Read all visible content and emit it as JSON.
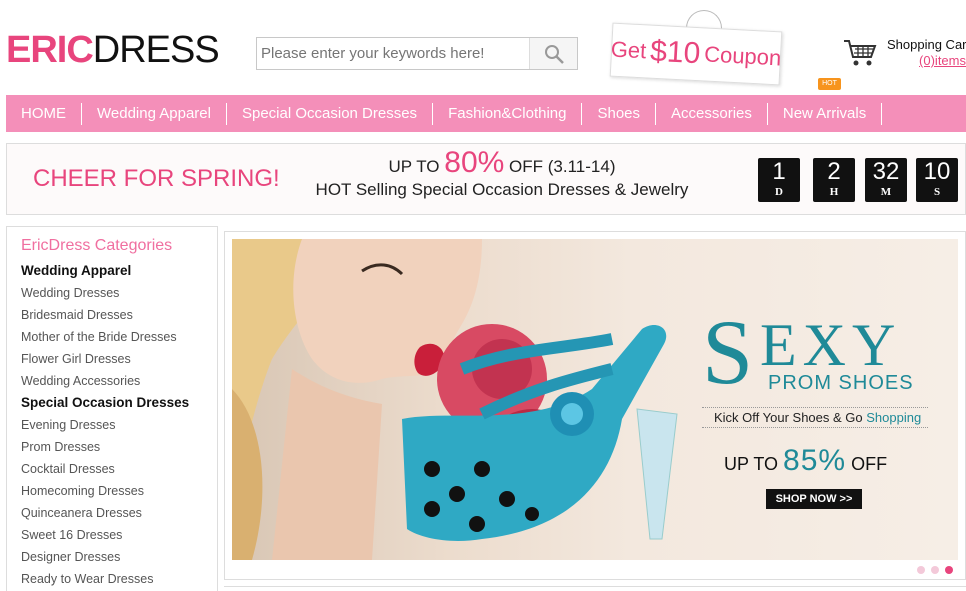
{
  "brand": {
    "logo_part1": "ERIC",
    "logo_part2": "DRESS"
  },
  "search": {
    "placeholder": "Please enter your keywords here!",
    "button_icon": "search-icon"
  },
  "coupon": {
    "text_before": "Get",
    "amount": "$10",
    "text_after": "Coupon"
  },
  "cart": {
    "label": "Shopping Cart",
    "items": "(0)items",
    "icon": "cart-icon"
  },
  "hot_badge": "HOT",
  "nav": {
    "items": [
      {
        "label": "HOME"
      },
      {
        "label": "Wedding Apparel"
      },
      {
        "label": "Special Occasion Dresses"
      },
      {
        "label": "Fashion&Clothing"
      },
      {
        "label": "Shoes"
      },
      {
        "label": "Accessories"
      },
      {
        "label": "New Arrivals"
      }
    ]
  },
  "promo": {
    "left": "CHEER FOR SPRING!",
    "up_to": "UP TO",
    "percent": "80%",
    "off_dates": "OFF (3.11-14)",
    "subline": "HOT Selling Special Occasion Dresses & Jewelry",
    "countdown": [
      {
        "value": "1",
        "unit": "D"
      },
      {
        "value": "2",
        "unit": "H"
      },
      {
        "value": "32",
        "unit": "M"
      },
      {
        "value": "10",
        "unit": "S"
      }
    ]
  },
  "sidebar": {
    "title": "EricDress Categories",
    "rows": [
      {
        "label": "Wedding Apparel",
        "group": true
      },
      {
        "label": "Wedding Dresses",
        "group": false
      },
      {
        "label": "Bridesmaid Dresses",
        "group": false
      },
      {
        "label": "Mother of the Bride Dresses",
        "group": false
      },
      {
        "label": "Flower Girl Dresses",
        "group": false
      },
      {
        "label": "Wedding Accessories",
        "group": false
      },
      {
        "label": "Special Occasion Dresses",
        "group": true
      },
      {
        "label": "Evening Dresses",
        "group": false
      },
      {
        "label": "Prom Dresses",
        "group": false
      },
      {
        "label": "Cocktail Dresses",
        "group": false
      },
      {
        "label": "Homecoming Dresses",
        "group": false
      },
      {
        "label": "Quinceanera Dresses",
        "group": false
      },
      {
        "label": "Sweet 16 Dresses",
        "group": false
      },
      {
        "label": "Designer Dresses",
        "group": false
      },
      {
        "label": "Ready to Wear Dresses",
        "group": false
      }
    ]
  },
  "hero": {
    "big_letter": "S",
    "rest": "EXY",
    "subtitle": "PROM SHOES",
    "kick": "Kick Off Your Shoes & Go",
    "kick_link": "Shopping",
    "up_to": "UP TO",
    "percent": "85%",
    "off": "OFF",
    "cta": "SHOP NOW >>",
    "slides": 3,
    "active_slide": 3
  },
  "colors": {
    "brand_pink": "#e8457d",
    "nav_pink": "#f48fb9",
    "teal": "#1f8a98"
  }
}
